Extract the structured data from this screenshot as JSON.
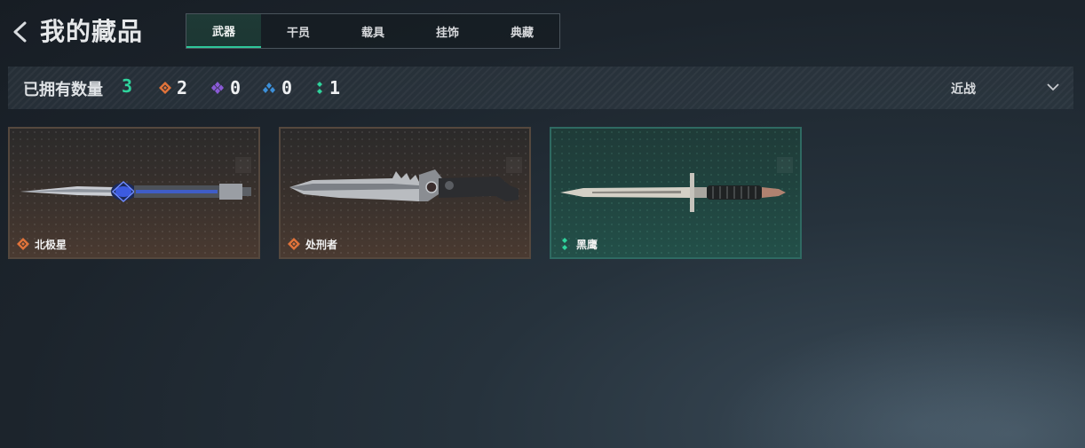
{
  "header": {
    "title": "我的藏品",
    "tabs": [
      {
        "label": "武器",
        "active": true
      },
      {
        "label": "干员",
        "active": false
      },
      {
        "label": "载具",
        "active": false
      },
      {
        "label": "挂饰",
        "active": false
      },
      {
        "label": "典藏",
        "active": false
      }
    ]
  },
  "stats": {
    "owned_label": "已拥有数量",
    "owned_count": "3",
    "rarities": [
      {
        "icon": "orange-diamond-icon",
        "color": "#e0733a",
        "count": "2"
      },
      {
        "icon": "purple-diamond-icon",
        "color": "#8a5ad6",
        "count": "0"
      },
      {
        "icon": "blue-diamond-icon",
        "color": "#3d8fd8",
        "count": "0"
      },
      {
        "icon": "green-dots-icon",
        "color": "#2fd39c",
        "count": "1"
      }
    ],
    "sort_label": "近战"
  },
  "items": [
    {
      "name": "北极星",
      "rarity": "orange",
      "weapon_icon": "polaris-knife-icon"
    },
    {
      "name": "处刑者",
      "rarity": "orange",
      "weapon_icon": "executioner-knife-icon"
    },
    {
      "name": "黑鹰",
      "rarity": "green",
      "weapon_icon": "black-hawk-bayonet-icon"
    }
  ],
  "colors": {
    "accent_green": "#2fd39c",
    "rarity_orange": "#e0733a"
  }
}
